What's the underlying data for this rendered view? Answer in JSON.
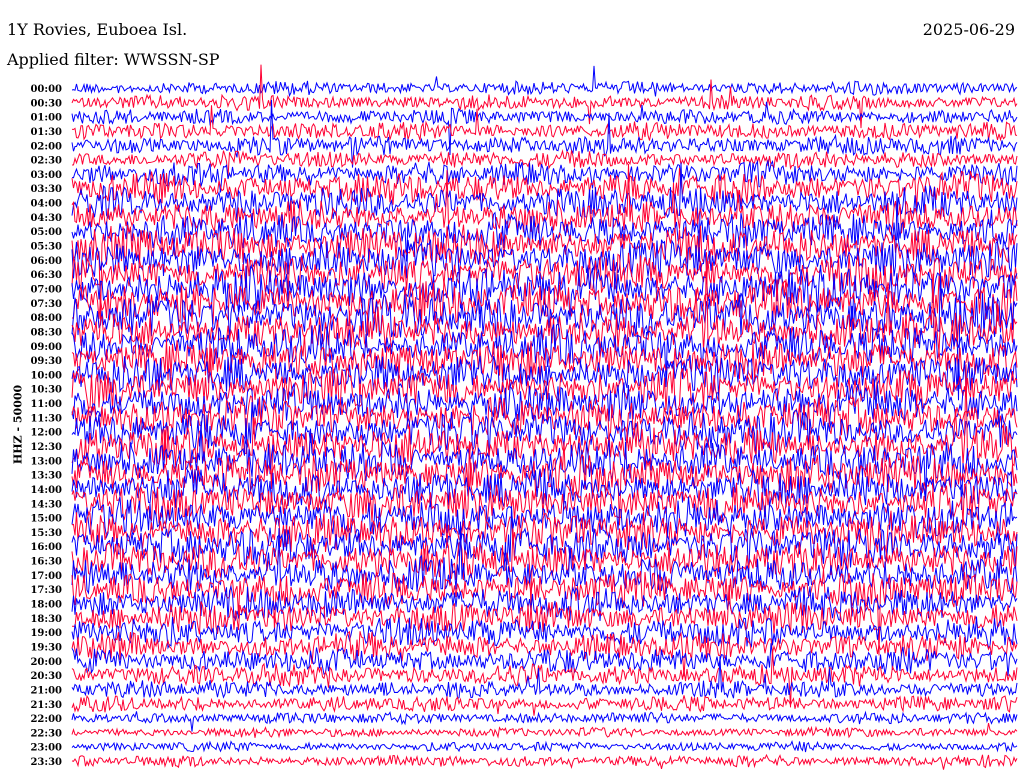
{
  "header": {
    "title": "1Y Rovies, Euboea Isl.",
    "filter": "Applied filter: WWSSN-SP",
    "date": "2025-06-29"
  },
  "chart_data": {
    "type": "line",
    "title": "1Y Rovies, Euboea Isl.",
    "subtitle": "Applied filter: WWSSN-SP",
    "date": "2025-06-29",
    "ylabel": "HHZ - 50000",
    "xlabel": "",
    "colors": [
      "#0000ff",
      "#ff0033"
    ],
    "row_labels": [
      "00:00",
      "00:30",
      "01:00",
      "01:30",
      "02:00",
      "02:30",
      "03:00",
      "03:30",
      "04:00",
      "04:30",
      "05:00",
      "05:30",
      "06:00",
      "06:30",
      "07:00",
      "07:30",
      "08:00",
      "08:30",
      "09:00",
      "09:30",
      "10:00",
      "10:30",
      "11:00",
      "11:30",
      "12:00",
      "12:30",
      "13:00",
      "13:30",
      "14:00",
      "14:30",
      "15:00",
      "15:30",
      "16:00",
      "16:30",
      "17:00",
      "17:30",
      "18:00",
      "18:30",
      "19:00",
      "19:30",
      "20:00",
      "20:30",
      "21:00",
      "21:30",
      "22:00",
      "22:30",
      "23:00",
      "23:30"
    ],
    "relative_amplitude": [
      0.35,
      0.4,
      0.4,
      0.45,
      0.5,
      0.45,
      0.6,
      0.8,
      0.8,
      0.85,
      0.9,
      1,
      1,
      1,
      1.1,
      1.1,
      1.1,
      1,
      1,
      1,
      1,
      1,
      1,
      1,
      1,
      1,
      1,
      1,
      1,
      1,
      1,
      1,
      1,
      0.95,
      0.9,
      0.9,
      0.85,
      0.8,
      0.75,
      0.7,
      0.65,
      0.55,
      0.45,
      0.4,
      0.3,
      0.25,
      0.25,
      0.3
    ]
  }
}
